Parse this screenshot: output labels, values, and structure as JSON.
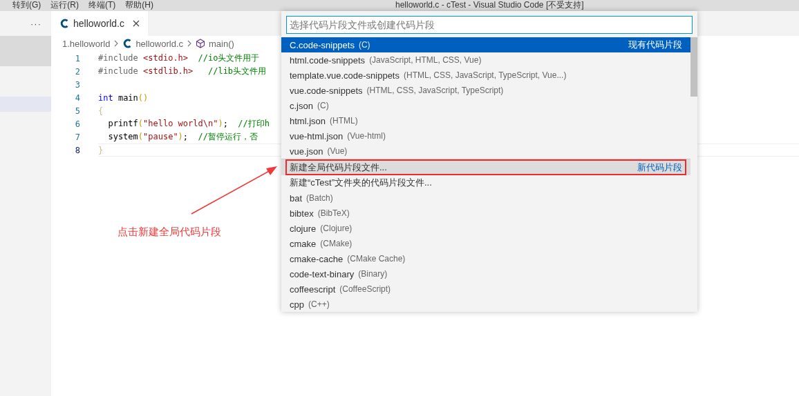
{
  "title_bar": {
    "menus": [
      "转到(G)",
      "运行(R)",
      "终端(T)",
      "帮助(H)"
    ],
    "title": "helloworld.c - cTest - Visual Studio Code [不受支持]"
  },
  "sidebar": {
    "more": "···"
  },
  "tabs": [
    {
      "label": "helloworld.c",
      "selected": true
    }
  ],
  "breadcrumb": [
    "1.helloworld",
    "helloworld.c",
    "main()"
  ],
  "code_lines": [
    {
      "number": "1",
      "current": false,
      "tokens": [
        {
          "kind": "preproc",
          "text": "#include "
        },
        {
          "kind": "string",
          "text": "<stdio.h>"
        },
        {
          "kind": "comment",
          "text": "  //io头文件用于"
        }
      ]
    },
    {
      "number": "2",
      "current": false,
      "tokens": [
        {
          "kind": "preproc",
          "text": "#include "
        },
        {
          "kind": "string",
          "text": "<stdlib.h>"
        },
        {
          "kind": "comment",
          "text": "   //lib头文件用"
        }
      ]
    },
    {
      "number": "3",
      "current": false
    },
    {
      "number": "4",
      "current": false,
      "tokens": [
        {
          "kind": "keyword",
          "text": "int"
        },
        {
          "kind": "plain",
          "text": " main"
        },
        {
          "kind": "bracket",
          "text": "()"
        }
      ]
    },
    {
      "number": "5",
      "current": false,
      "tokens": [
        {
          "kind": "brace",
          "text": "{"
        }
      ]
    },
    {
      "number": "6",
      "current": false,
      "tokens": [
        {
          "kind": "plain",
          "text": "  printf"
        },
        {
          "kind": "bracket",
          "text": "("
        },
        {
          "kind": "string",
          "text": "\"hello world\\n\""
        },
        {
          "kind": "bracket",
          "text": ")"
        },
        {
          "kind": "plain",
          "text": ";  "
        },
        {
          "kind": "comment",
          "text": "//打印h"
        }
      ]
    },
    {
      "number": "7",
      "current": false,
      "tokens": [
        {
          "kind": "plain",
          "text": "  system"
        },
        {
          "kind": "bracket",
          "text": "("
        },
        {
          "kind": "string",
          "text": "\"pause\""
        },
        {
          "kind": "bracket",
          "text": ")"
        },
        {
          "kind": "plain",
          "text": ";  "
        },
        {
          "kind": "comment",
          "text": "//暂停运行，否"
        }
      ]
    },
    {
      "number": "8",
      "current": true,
      "tokens": [
        {
          "kind": "brace",
          "text": "}"
        }
      ]
    }
  ],
  "quick_pick": {
    "placeholder": "选择代码片段文件或创建代码片段",
    "items": [
      {
        "label": "C.code-snippets",
        "description": "(C)",
        "group_label": "现有代码片段",
        "separator": false,
        "selected": true,
        "hovered": false,
        "annotated": false
      },
      {
        "label": "html.code-snippets",
        "description": "(JavaScript, HTML, CSS, Vue)",
        "separator": false,
        "selected": false,
        "hovered": false,
        "annotated": false
      },
      {
        "label": "template.vue.code-snippets",
        "description": "(HTML, CSS, JavaScript, TypeScript, Vue...)",
        "separator": false,
        "selected": false,
        "hovered": false,
        "annotated": false
      },
      {
        "label": "vue.code-snippets",
        "description": "(HTML, CSS, JavaScript, TypeScript)",
        "separator": false,
        "selected": false,
        "hovered": false,
        "annotated": false
      },
      {
        "label": "c.json",
        "description": "(C)",
        "separator": false,
        "selected": false,
        "hovered": false,
        "annotated": false
      },
      {
        "label": "html.json",
        "description": "(HTML)",
        "separator": false,
        "selected": false,
        "hovered": false,
        "annotated": false
      },
      {
        "label": "vue-html.json",
        "description": "(Vue-html)",
        "separator": false,
        "selected": false,
        "hovered": false,
        "annotated": false
      },
      {
        "label": "vue.json",
        "description": "(Vue)",
        "separator": false,
        "selected": false,
        "hovered": false,
        "annotated": false
      },
      {
        "label": "新建全局代码片段文件...",
        "group_label": "新代码片段",
        "separator": true,
        "selected": false,
        "hovered": true,
        "annotated": true
      },
      {
        "label": "新建“cTest”文件夹的代码片段文件...",
        "separator": false,
        "selected": false,
        "hovered": false,
        "annotated": false
      },
      {
        "label": "bat",
        "description": "(Batch)",
        "separator": false,
        "selected": false,
        "hovered": false,
        "annotated": false
      },
      {
        "label": "bibtex",
        "description": "(BibTeX)",
        "separator": false,
        "selected": false,
        "hovered": false,
        "annotated": false
      },
      {
        "label": "clojure",
        "description": "(Clojure)",
        "separator": false,
        "selected": false,
        "hovered": false,
        "annotated": false
      },
      {
        "label": "cmake",
        "description": "(CMake)",
        "separator": false,
        "selected": false,
        "hovered": false,
        "annotated": false
      },
      {
        "label": "cmake-cache",
        "description": "(CMake Cache)",
        "separator": false,
        "selected": false,
        "hovered": false,
        "annotated": false
      },
      {
        "label": "code-text-binary",
        "description": "(Binary)",
        "separator": false,
        "selected": false,
        "hovered": false,
        "annotated": false
      },
      {
        "label": "coffeescript",
        "description": "(CoffeeScript)",
        "separator": false,
        "selected": false,
        "hovered": false,
        "annotated": false
      },
      {
        "label": "cpp",
        "description": "(C++)",
        "separator": false,
        "selected": false,
        "hovered": false,
        "annotated": false
      }
    ]
  },
  "annotation": {
    "text": "点击新建全局代码片段"
  }
}
